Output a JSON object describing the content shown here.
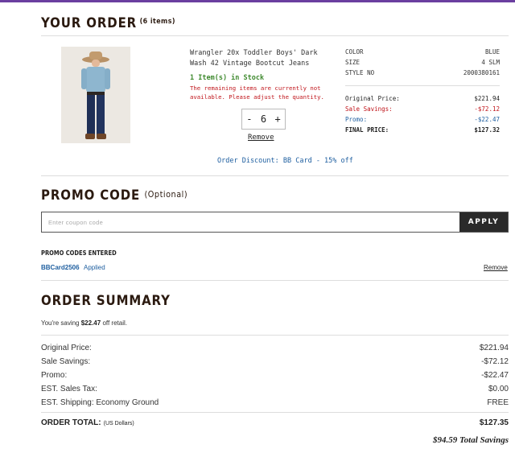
{
  "order": {
    "title": "YOUR ORDER",
    "item_count": "(6 items)"
  },
  "product": {
    "name": "Wrangler 20x Toddler Boys' Dark Wash 42 Vintage Bootcut Jeans",
    "stock": "1 Item(s) in Stock",
    "stock_warning": "The remaining items are currently not available. Please adjust the quantity.",
    "qty_minus": "-",
    "qty_value": "6",
    "qty_plus": "+",
    "remove_label": "Remove",
    "order_discount": "Order Discount: BB Card - 15% off",
    "attributes": [
      {
        "label": "COLOR",
        "value": "BLUE"
      },
      {
        "label": "SIZE",
        "value": "4 SLM"
      },
      {
        "label": "STYLE NO",
        "value": "2000380161"
      }
    ],
    "prices": {
      "original_label": "Original Price:",
      "original_value": "$221.94",
      "sale_label": "Sale Savings:",
      "sale_value": "-$72.12",
      "promo_label": "Promo:",
      "promo_value": "-$22.47",
      "final_label": "FINAL PRICE:",
      "final_value": "$127.32"
    }
  },
  "promo": {
    "title": "PROMO CODE",
    "optional": "(Optional)",
    "placeholder": "Enter coupon code",
    "apply_label": "APPLY",
    "entered_title": "PROMO CODES ENTERED",
    "code": "BBCard2506",
    "status": "Applied",
    "remove_label": "Remove"
  },
  "summary": {
    "title": "ORDER SUMMARY",
    "saving_prefix": "You're saving",
    "saving_amount": "$22.47",
    "saving_suffix": "off retail.",
    "rows": [
      {
        "label": "Original Price:",
        "value": "$221.94"
      },
      {
        "label": "Sale Savings:",
        "value": "-$72.12"
      },
      {
        "label": "Promo:",
        "value": "-$22.47"
      },
      {
        "label": "EST. Sales Tax:",
        "value": "$0.00"
      },
      {
        "label": "EST. Shipping: Economy Ground",
        "value": "FREE"
      }
    ],
    "total_label": "ORDER TOTAL:",
    "total_unit": "(US Dollars)",
    "total_value": "$127.35",
    "total_saving": "$94.59 Total Savings"
  },
  "colors": {
    "accent_purple": "#6b3fa0",
    "heading": "#2b1a10",
    "savings_red": "#c0151b",
    "promo_blue": "#1f5fa0",
    "stock_green": "#3f8a2f"
  }
}
